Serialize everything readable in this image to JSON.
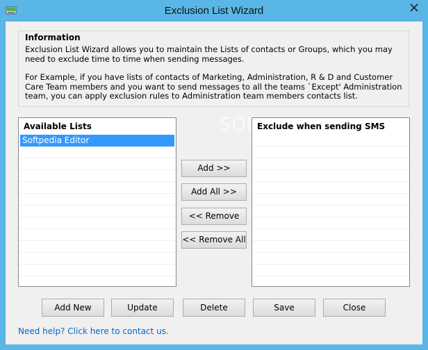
{
  "window": {
    "title": "Exclusion List Wizard"
  },
  "info": {
    "heading": "Information",
    "para1": "Exclusion List Wizard allows you to maintain the Lists of contacts or Groups, which you may need to exclude time to time when sending messages.",
    "para2": "For Example, if you have lists of contacts of Marketing, Administration, R & D and Customer Care Team members and you want to send messages to all the teams `Except' Administration team, you can apply exclusion rules to Administration team members contacts list."
  },
  "available_lists": {
    "header": "Available Lists",
    "items": [
      "Softpedia Editor"
    ],
    "selected_index": 0
  },
  "exclude_list": {
    "header": "Exclude when sending SMS",
    "items": []
  },
  "transfer_buttons": {
    "add": "Add >>",
    "add_all": "Add All >>",
    "remove": "<< Remove",
    "remove_all": "<< Remove All"
  },
  "action_buttons": {
    "add_new": "Add New",
    "update": "Update",
    "delete": "Delete",
    "save": "Save",
    "close": "Close"
  },
  "help_link": "Need help? Click here to contact us.",
  "watermark": "SOFTPEDIA",
  "colors": {
    "frame": "#59b6e6",
    "selection": "#3399ff",
    "link": "#0066cc"
  }
}
